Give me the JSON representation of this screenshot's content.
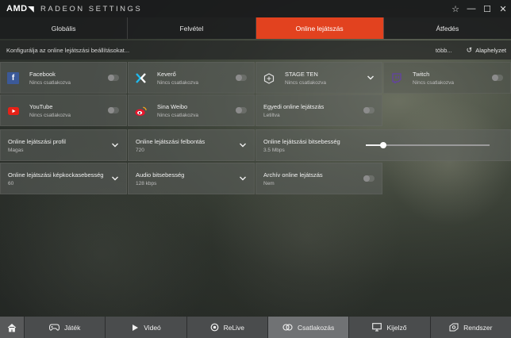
{
  "titlebar": {
    "logo": "AMD",
    "logo_mark": "◥",
    "app_title": "RADEON SETTINGS",
    "star": "☆",
    "minimize": "—",
    "maximize": "☐",
    "close": "✕"
  },
  "tabs": [
    {
      "label": "Globális",
      "active": false
    },
    {
      "label": "Felvétel",
      "active": false
    },
    {
      "label": "Online lejátszás",
      "active": true
    },
    {
      "label": "Átfedés",
      "active": false
    }
  ],
  "subheader": {
    "description": "Konfigurálja az online lejátszási beállításokat...",
    "more": "több...",
    "reset_icon": "↺",
    "reset": "Alaphelyzet"
  },
  "services": [
    {
      "name": "Facebook",
      "status": "Nincs csatlakozva",
      "icon": "facebook-icon"
    },
    {
      "name": "Keverő",
      "status": "Nincs csatlakozva",
      "icon": "mixer-icon"
    },
    {
      "name": "STAGE TEN",
      "status": "Nincs csatlakozva",
      "icon": "stage-ten-icon"
    },
    {
      "name": "Twitch",
      "status": "Nincs csatlakozva",
      "icon": "twitch-icon"
    },
    {
      "name": "YouTube",
      "status": "Nincs csatlakozva",
      "icon": "youtube-icon"
    },
    {
      "name": "Sina Weibo",
      "status": "Nincs csatlakozva",
      "icon": "sina-weibo-icon"
    },
    {
      "name": "Egyedi online lejátszás",
      "status": "Letiltva"
    }
  ],
  "settings": {
    "profile": {
      "label": "Online lejátszási profil",
      "value": "Magas"
    },
    "resolution": {
      "label": "Online lejátszási felbontás",
      "value": "720"
    },
    "bitrate": {
      "label": "Online lejátszási bitsebesség",
      "value": "3.5 Mbps",
      "slider_fraction": 0.14
    },
    "framerate": {
      "label": "Online lejátszási képkockasebesség",
      "value": "60"
    },
    "audio": {
      "label": "Audio bitsebesség",
      "value": "128 kbps"
    },
    "archive": {
      "label": "Archív online lejátszás",
      "value": "Nem"
    }
  },
  "bottomnav": [
    {
      "label": "",
      "icon": "home-icon"
    },
    {
      "label": "Játék",
      "icon": "gamepad-icon"
    },
    {
      "label": "Videó",
      "icon": "play-icon"
    },
    {
      "label": "ReLive",
      "icon": "relive-icon"
    },
    {
      "label": "Csatlakozás",
      "icon": "connect-icon",
      "active": true
    },
    {
      "label": "Kijelző",
      "icon": "display-icon"
    },
    {
      "label": "Rendszer",
      "icon": "system-icon"
    }
  ],
  "colors": {
    "accent": "#e2421f",
    "facebook": "#3b5998",
    "mixer": "#1fbaed",
    "twitch": "#6441a4",
    "youtube": "#e62117",
    "weibo": "#e6162d"
  }
}
